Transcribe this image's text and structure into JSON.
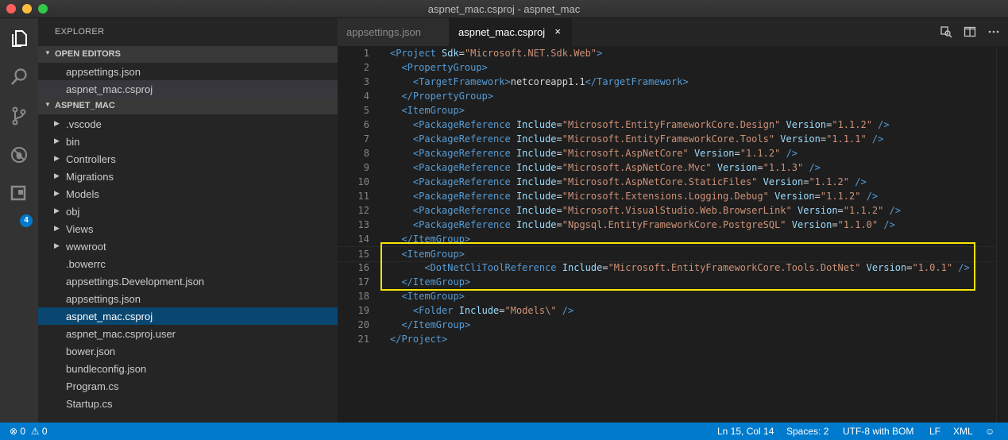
{
  "window": {
    "title": "aspnet_mac.csproj - aspnet_mac"
  },
  "activity_bar": {
    "items": [
      {
        "icon": "files-icon"
      },
      {
        "icon": "search-icon"
      },
      {
        "icon": "source-control-icon"
      },
      {
        "icon": "debug-icon"
      },
      {
        "icon": "extensions-icon"
      }
    ],
    "extensions_badge": "4"
  },
  "sidebar": {
    "title": "EXPLORER",
    "open_editors": {
      "header": "OPEN EDITORS",
      "items": [
        "appsettings.json",
        "aspnet_mac.csproj"
      ]
    },
    "project": {
      "header": "ASPNET_MAC",
      "folders": [
        ".vscode",
        "bin",
        "Controllers",
        "Migrations",
        "Models",
        "obj",
        "Views",
        "wwwroot"
      ],
      "files": [
        ".bowerrc",
        "appsettings.Development.json",
        "appsettings.json",
        "aspnet_mac.csproj",
        "aspnet_mac.csproj.user",
        "bower.json",
        "bundleconfig.json",
        "Program.cs",
        "Startup.cs"
      ]
    }
  },
  "tabs": [
    {
      "label": "appsettings.json",
      "active": false
    },
    {
      "label": "aspnet_mac.csproj",
      "active": true,
      "close": "×"
    }
  ],
  "editor": {
    "lines": [
      {
        "n": "1",
        "text": "<Project Sdk=\"Microsoft.NET.Sdk.Web\">"
      },
      {
        "n": "2",
        "text": "  <PropertyGroup>"
      },
      {
        "n": "3",
        "text": "    <TargetFramework>netcoreapp1.1</TargetFramework>"
      },
      {
        "n": "4",
        "text": "  </PropertyGroup>"
      },
      {
        "n": "5",
        "text": "  <ItemGroup>"
      },
      {
        "n": "6",
        "text": "    <PackageReference Include=\"Microsoft.EntityFrameworkCore.Design\" Version=\"1.1.2\" />"
      },
      {
        "n": "7",
        "text": "    <PackageReference Include=\"Microsoft.EntityFrameworkCore.Tools\" Version=\"1.1.1\" />"
      },
      {
        "n": "8",
        "text": "    <PackageReference Include=\"Microsoft.AspNetCore\" Version=\"1.1.2\" />"
      },
      {
        "n": "9",
        "text": "    <PackageReference Include=\"Microsoft.AspNetCore.Mvc\" Version=\"1.1.3\" />"
      },
      {
        "n": "10",
        "text": "    <PackageReference Include=\"Microsoft.AspNetCore.StaticFiles\" Version=\"1.1.2\" />"
      },
      {
        "n": "11",
        "text": "    <PackageReference Include=\"Microsoft.Extensions.Logging.Debug\" Version=\"1.1.2\" />"
      },
      {
        "n": "12",
        "text": "    <PackageReference Include=\"Microsoft.VisualStudio.Web.BrowserLink\" Version=\"1.1.2\" />"
      },
      {
        "n": "13",
        "text": "    <PackageReference Include=\"Npgsql.EntityFrameworkCore.PostgreSQL\" Version=\"1.1.0\" />"
      },
      {
        "n": "14",
        "text": "  </ItemGroup>"
      },
      {
        "n": "15",
        "text": "  <ItemGroup>"
      },
      {
        "n": "16",
        "text": "      <DotNetCliToolReference Include=\"Microsoft.EntityFrameworkCore.Tools.DotNet\" Version=\"1.0.1\" />"
      },
      {
        "n": "17",
        "text": "  </ItemGroup>"
      },
      {
        "n": "18",
        "text": "  <ItemGroup>"
      },
      {
        "n": "19",
        "text": "    <Folder Include=\"Models\\\" />"
      },
      {
        "n": "20",
        "text": "  </ItemGroup>"
      },
      {
        "n": "21",
        "text": "</Project>"
      }
    ]
  },
  "status_bar": {
    "errors": "0",
    "warnings": "0",
    "position": "Ln 15, Col 14",
    "spaces": "Spaces: 2",
    "encoding": "UTF-8 with BOM",
    "eol": "LF",
    "language": "XML"
  }
}
